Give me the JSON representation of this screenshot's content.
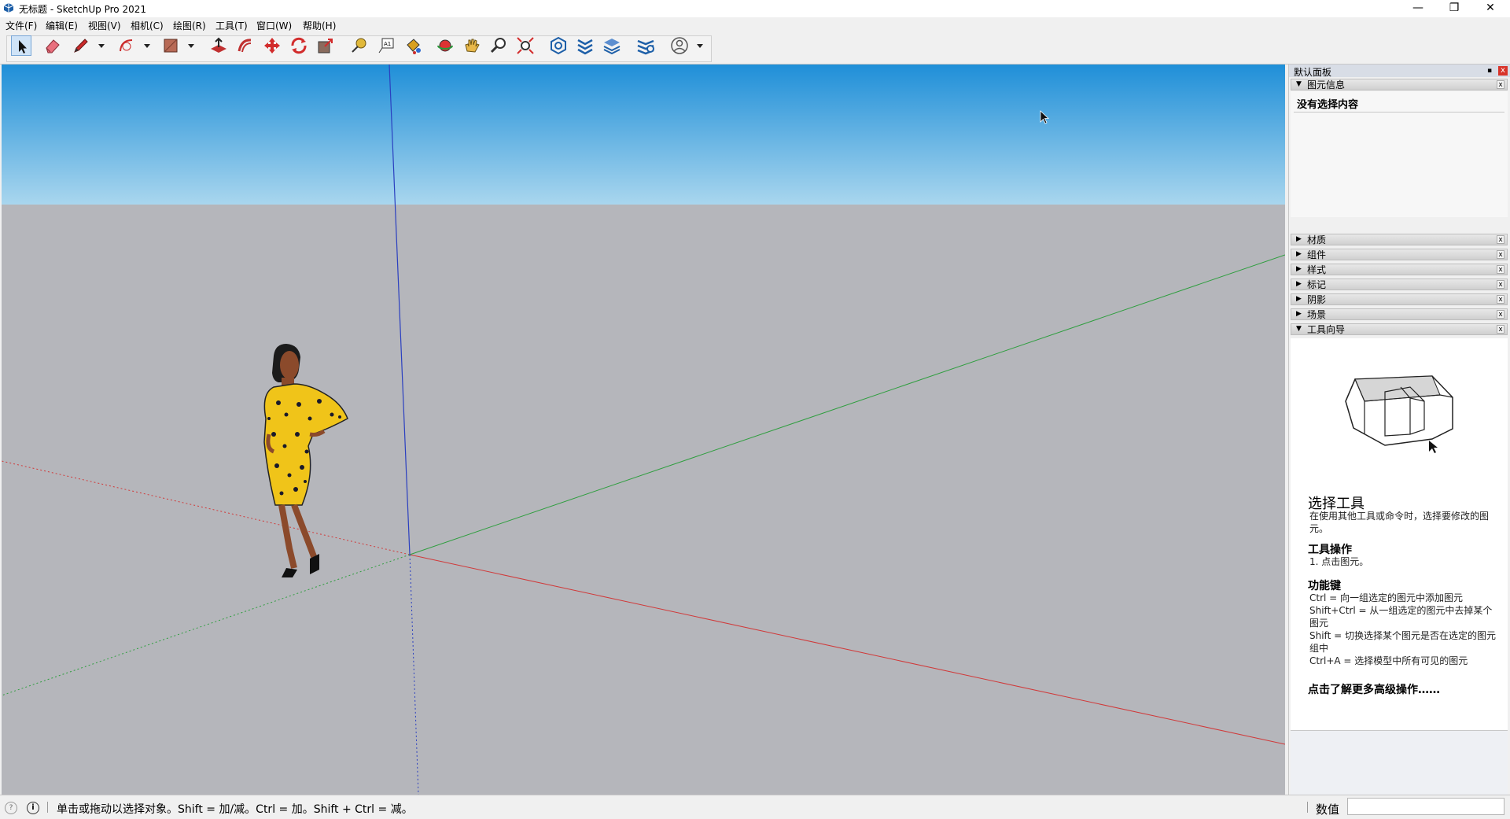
{
  "window": {
    "title": "无标题 - SketchUp Pro 2021",
    "minimize": "—",
    "restore": "❐",
    "close": "✕"
  },
  "menu": [
    "文件(F)",
    "编辑(E)",
    "视图(V)",
    "相机(C)",
    "绘图(R)",
    "工具(T)",
    "窗口(W)",
    "帮助(H)"
  ],
  "toolbar": {
    "tools": [
      "select-icon",
      "eraser-icon",
      "pencil-icon",
      "arc-icon",
      "rectangle-icon",
      "pushpull-icon",
      "offset-icon",
      "move-icon",
      "rotate-icon",
      "scale-icon",
      "tape-measure-icon",
      "text-icon",
      "paint-bucket-icon",
      "orbit-icon",
      "pan-icon",
      "zoom-icon",
      "zoom-extents-icon",
      "warehouse-icon",
      "extension-warehouse-icon",
      "layout-icon",
      "extension-manager-icon",
      "account-icon"
    ]
  },
  "colors": {
    "sky_top": "#1f8fd8",
    "sky_bottom": "#a9d6ee",
    "ground": "#b5b6bb",
    "axis_red": "#d03a3a",
    "axis_green": "#2f9e3f",
    "axis_blue": "#2a3fc0",
    "panel_close": "#d8342a"
  },
  "panel": {
    "title": "默认面板",
    "pin": "▪",
    "close": "x",
    "entity_info": {
      "label": "图元信息",
      "status": "没有选择内容"
    },
    "sections": [
      "材质",
      "组件",
      "样式",
      "标记",
      "阴影",
      "场景",
      "工具向导"
    ],
    "instructor": {
      "title": "选择工具",
      "intro": "在使用其他工具或命令时，选择要修改的图元。",
      "ops_title": "工具操作",
      "ops": "1. 点击图元。",
      "keys_title": "功能键",
      "keys": [
        "Ctrl = 向一组选定的图元中添加图元",
        "Shift+Ctrl = 从一组选定的图元中去掉某个图元",
        "Shift = 切换选择某个图元是否在选定的图元组中",
        "Ctrl+A = 选择模型中所有可见的图元"
      ],
      "more": "点击了解更多高级操作……"
    }
  },
  "status": {
    "message": "单击或拖动以选择对象。Shift = 加/减。Ctrl = 加。Shift + Ctrl = 减。",
    "value_label": "数值",
    "info_icon": "?",
    "tip_icon": "i"
  }
}
